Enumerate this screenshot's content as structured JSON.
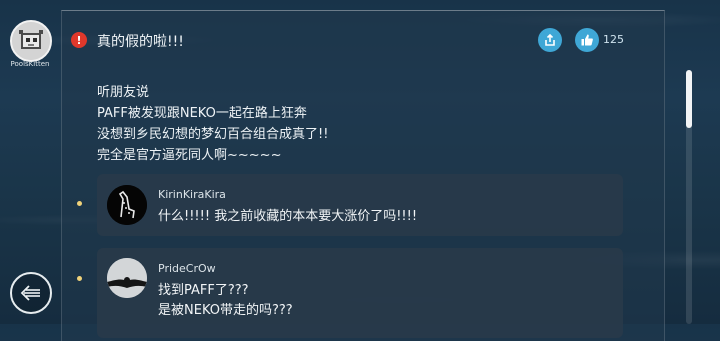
{
  "user": {
    "name": "PoolsKitten",
    "avatar_icon": "pixel-cat-icon"
  },
  "post": {
    "title": "真的假的啦!!!",
    "lines": [
      "听朋友说",
      "PAFF被发现跟NEKO一起在路上狂奔",
      "没想到乡民幻想的梦幻百合组合成真了!!",
      "完全是官方逼死同人啊~~~~~"
    ],
    "like_count": "125"
  },
  "actions": {
    "share_icon": "share-icon",
    "like_icon": "thumbs-up-icon",
    "back_icon": "back-arrow-icon"
  },
  "comments": [
    {
      "name": "KirinKiraKira",
      "lines": [
        "什么!!!!! 我之前收藏的本本要大涨价了吗!!!!"
      ]
    },
    {
      "name": "PrideCrOw",
      "lines": [
        "找到PAFF了???",
        "是被NEKO带走的吗???"
      ]
    }
  ],
  "colors": {
    "accent": "#3fa7d6",
    "alert": "#e0382b",
    "bullet": "#f0d27a"
  }
}
